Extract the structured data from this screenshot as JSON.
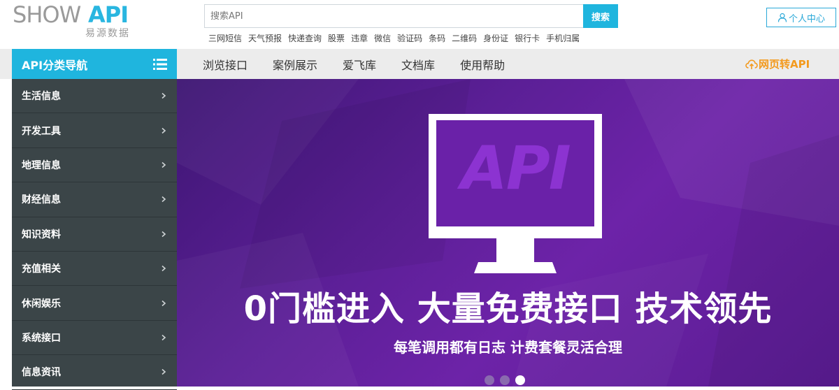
{
  "logo": {
    "show": "SHOW",
    "api": "API",
    "sub": "易源数据"
  },
  "search": {
    "placeholder": "搜索API",
    "button": "搜索"
  },
  "hot_links": [
    "三网短信",
    "天气预报",
    "快递查询",
    "股票",
    "违章",
    "微信",
    "验证码",
    "条码",
    "二维码",
    "身份证",
    "银行卡",
    "手机归属"
  ],
  "user_center": {
    "label": "个人中心",
    "icon": "user-icon"
  },
  "nav": {
    "category_title": "API分类导航",
    "category_icon": "list-icon",
    "links": [
      "浏览接口",
      "案例展示",
      "爱飞库",
      "文档库",
      "使用帮助"
    ],
    "web2api": "网页转API",
    "web2api_icon": "cloud-upload-icon"
  },
  "sidebar": {
    "items": [
      "生活信息",
      "开发工具",
      "地理信息",
      "财经信息",
      "知识资料",
      "充值相关",
      "休闲娱乐",
      "系统接口",
      "信息资讯"
    ]
  },
  "banner": {
    "monitor_text": "API",
    "headline": "0门槛进入 大量免费接口 技术领先",
    "subline": "每笔调用都有日志 计费套餐灵活合理",
    "slides": 3,
    "active_slide": 3
  },
  "colors": {
    "accent": "#1fb5de",
    "sidebar_bg": "#3b4548",
    "orange": "#f39a1e",
    "banner_purple": "#5b1f96"
  }
}
